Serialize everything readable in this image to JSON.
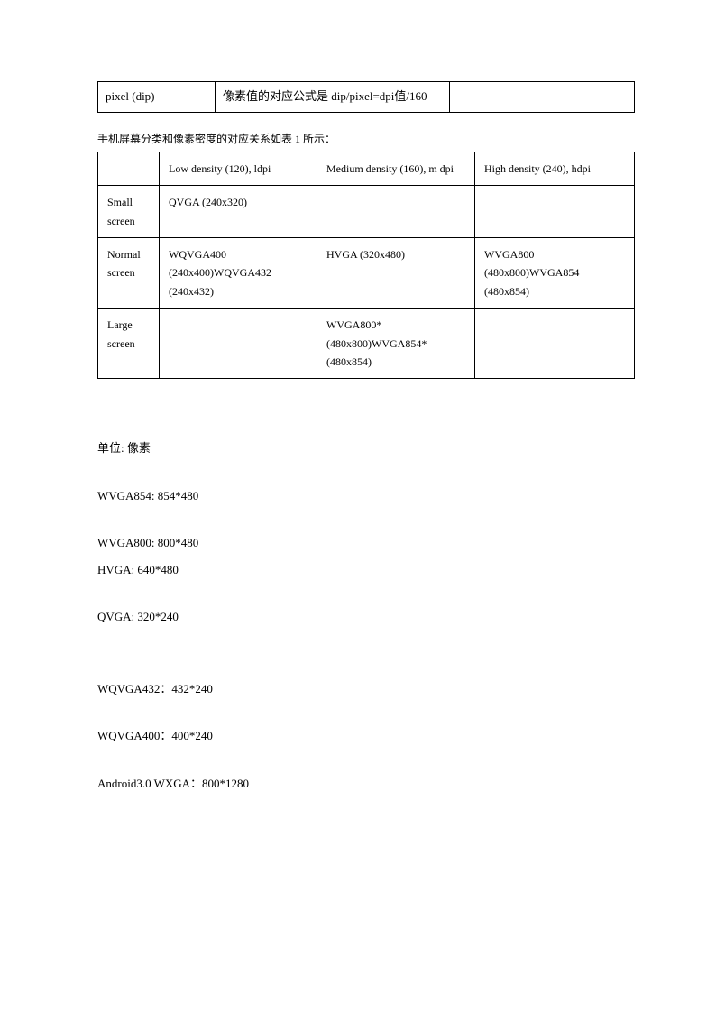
{
  "table1": {
    "r0c0": "pixel (dip)",
    "r0c1": "像素值的对应公式是 dip/pixel=dpi值/160",
    "r0c2": ""
  },
  "caption": "手机屏幕分类和像素密度的对应关系如表 1 所示：",
  "table2": {
    "header": {
      "c0": "",
      "c1": "Low density (120), ldpi",
      "c2": "Medium density (160), m dpi",
      "c3": "High density (240), hdpi"
    },
    "rows": [
      {
        "label": "Small screen",
        "c1": "QVGA (240x320)",
        "c2": "",
        "c3": ""
      },
      {
        "label": "Normal screen",
        "c1": "WQVGA400 (240x400)WQVGA432 (240x432)",
        "c2": "HVGA (320x480)",
        "c3": "WVGA800 (480x800)WVGA854 (480x854)"
      },
      {
        "label": "Large screen",
        "c1": "",
        "c2": "WVGA800* (480x800)WVGA854* (480x854)",
        "c3": ""
      }
    ]
  },
  "body": {
    "p0": "单位: 像素",
    "p1": "WVGA854: 854*480",
    "p2": "WVGA800: 800*480",
    "p3": "HVGA: 640*480",
    "p4": "QVGA: 320*240",
    "p5": "WQVGA432：432*240",
    "p6": "WQVGA400：400*240",
    "p7": "Android3.0 WXGA：800*1280"
  }
}
